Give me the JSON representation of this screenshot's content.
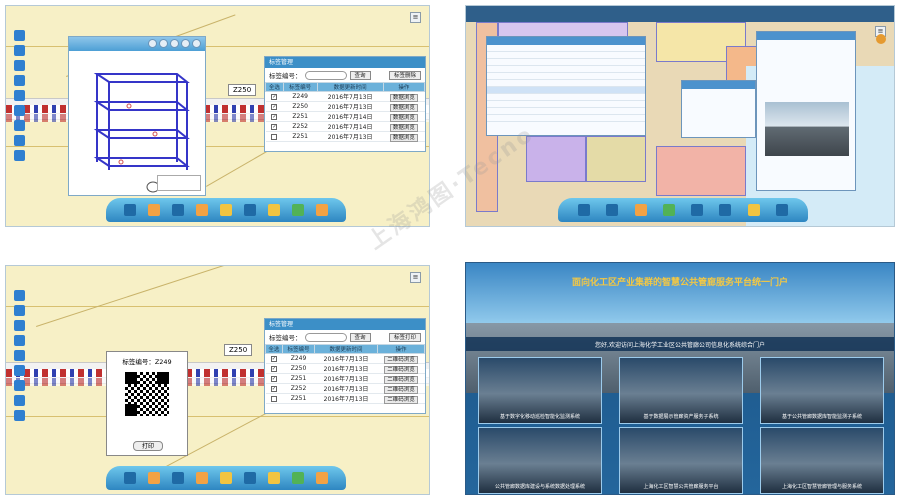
{
  "panel1": {
    "table": {
      "title": "标签管理",
      "search_label": "标签编号：",
      "query_button": "查询",
      "delete_button": "标签删除",
      "headers": [
        "全选",
        "标签编号",
        "数据更新时间",
        "操作"
      ],
      "rows": [
        {
          "checked": true,
          "id": "Z249",
          "date": "2016年7月13日",
          "action": "数据浏览"
        },
        {
          "checked": true,
          "id": "Z250",
          "date": "2016年7月13日",
          "action": "数据浏览"
        },
        {
          "checked": true,
          "id": "Z251",
          "date": "2016年7月14日",
          "action": "数据浏览"
        },
        {
          "checked": true,
          "id": "Z252",
          "date": "2016年7月14日",
          "action": "数据浏览"
        },
        {
          "checked": false,
          "id": "Z251",
          "date": "2016年7月13日",
          "action": "数据浏览"
        }
      ]
    },
    "map_label": "Z250"
  },
  "panel3": {
    "table": {
      "title": "标签管理",
      "search_label": "标签编号：",
      "query_button": "查询",
      "print_button": "标签打印",
      "headers": [
        "全选",
        "标签编号",
        "数据更新时间",
        "操作"
      ],
      "rows": [
        {
          "checked": true,
          "id": "Z249",
          "date": "2016年7月13日",
          "action": "二维码浏览"
        },
        {
          "checked": true,
          "id": "Z250",
          "date": "2016年7月13日",
          "action": "二维码浏览"
        },
        {
          "checked": true,
          "id": "Z251",
          "date": "2016年7月13日",
          "action": "二维码浏览"
        },
        {
          "checked": true,
          "id": "Z252",
          "date": "2016年7月13日",
          "action": "二维码浏览"
        },
        {
          "checked": false,
          "id": "Z251",
          "date": "2016年7月13日",
          "action": "二维码浏览"
        }
      ]
    },
    "map_label": "Z250",
    "qr_title": "标签编号：Z249",
    "qr_print": "打印"
  },
  "panel4": {
    "title": "面向化工区产业集群的智慧公共管廊服务平台统一门户",
    "welcome": "您好,欢迎访问上海化学工业区公共管廊公司信息化系统综合门户",
    "tiles": [
      "基于数字化移动巡检智能化监测系统",
      "基于数据展示管廊资产服务子系统",
      "基于公共管廊数据库智能监测子系统",
      "公共管廊数据库建设与系统数据处理系统",
      "上海化工区智慧公共管廊服务平台",
      "上海化工区智慧管廊管理与服务系统"
    ]
  },
  "watermark": "上海鸿图·Tecno"
}
